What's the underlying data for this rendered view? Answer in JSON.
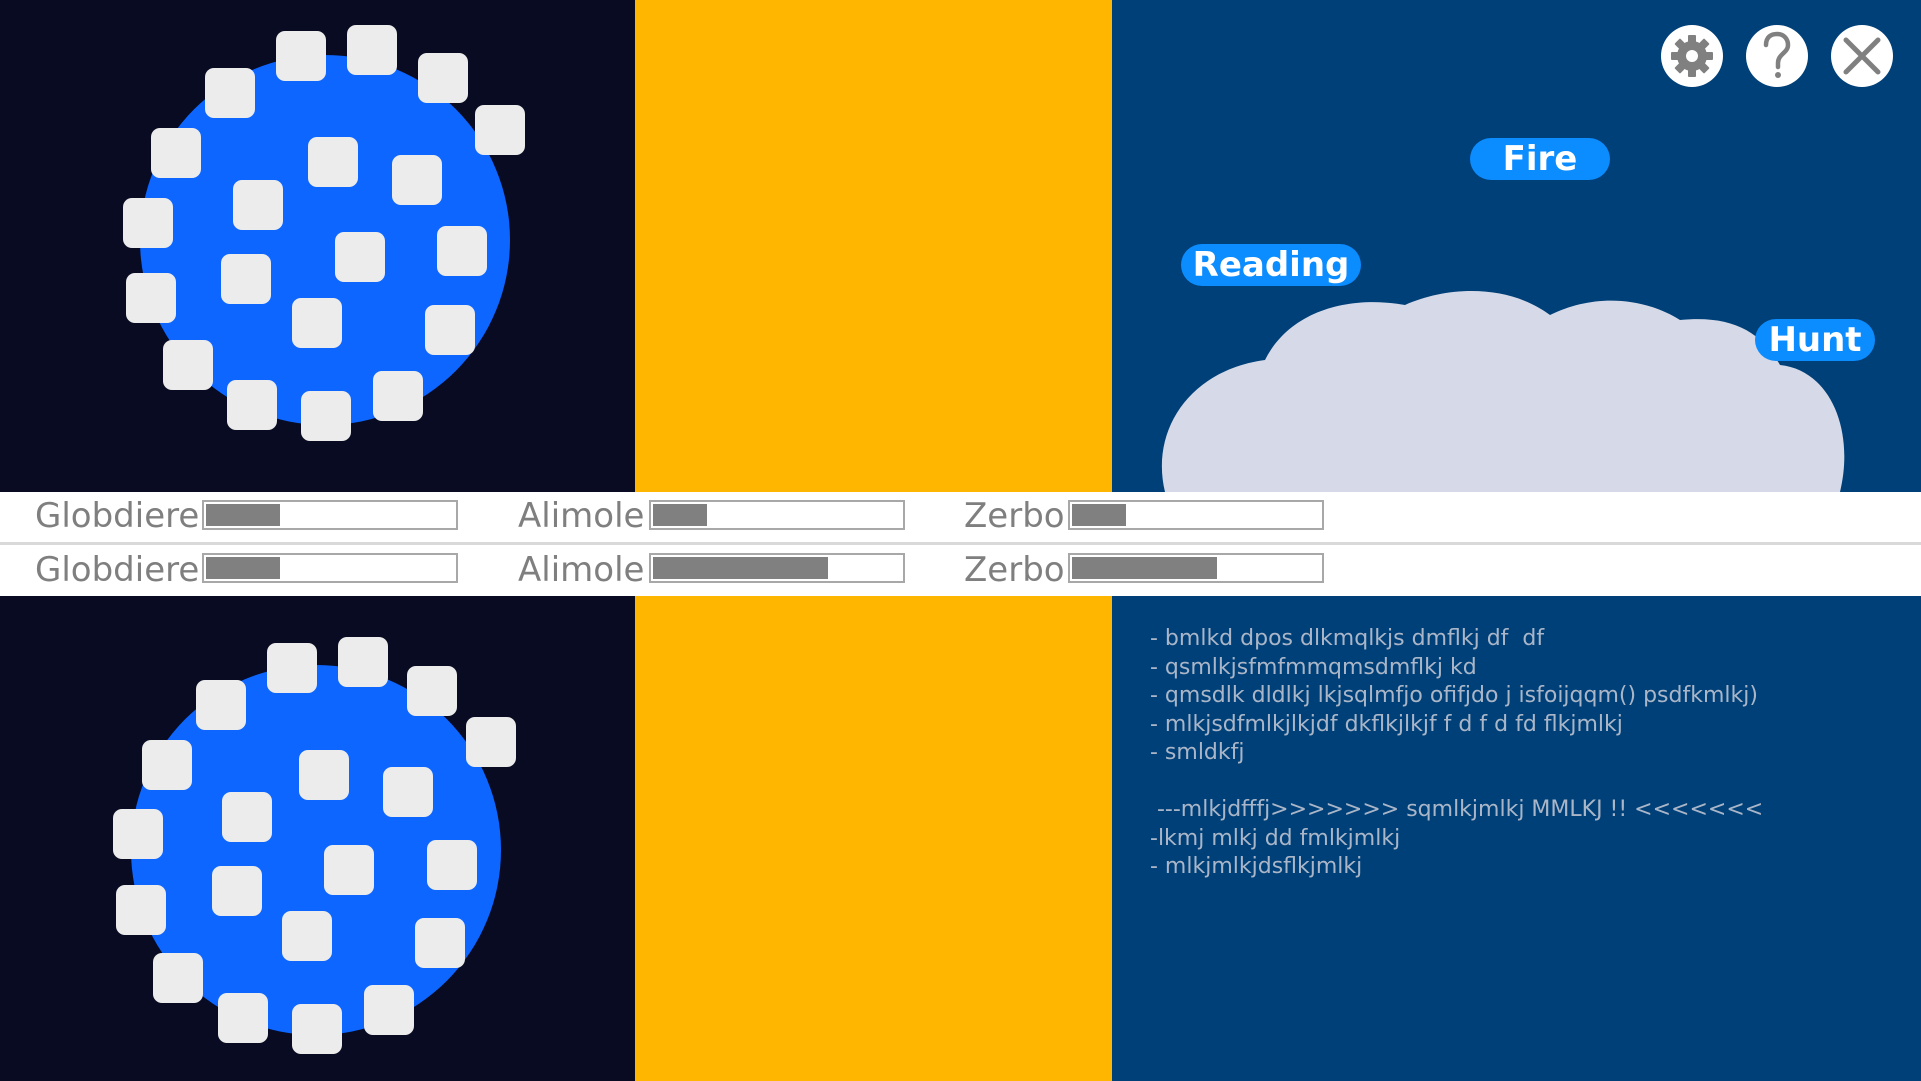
{
  "controls": {
    "settings_icon": "gear-icon",
    "help_icon": "question-icon",
    "close_icon": "close-icon"
  },
  "tags": {
    "fire": "Fire",
    "reading": "Reading",
    "hunt": "Hunt"
  },
  "stats": {
    "row1": [
      {
        "label": "Globdiere",
        "value": 0.31
      },
      {
        "label": "Alimole",
        "value": 0.23
      },
      {
        "label": "Zerbo",
        "value": 0.23
      }
    ],
    "row2": [
      {
        "label": "Globdiere",
        "value": 0.31
      },
      {
        "label": "Alimole",
        "value": 0.71
      },
      {
        "label": "Zerbo",
        "value": 0.59
      }
    ]
  },
  "notes": "- bmlkd dpos dlkmqlkjs dmflkj df  df\n- qsmlkjsfmfmmqmsdmflkj kd\n- qmsdlk dldlkj lkjsqlmfjo ofifjdo j isfoijqqm() psdfkmlkj)\n- mlkjsdfmlkjlkjdf dkflkjlkjf f d f d fd flkjmlkj\n- smldkfj\n\n ---mlkjdfffj>>>>>>> sqmlkjmlkj MMLKJ !! <<<<<<<\n-lkmj mlkj dd fmlkjmlkj\n- mlkjmlkjdsflkjmlkj",
  "colors": {
    "dark": "#080b22",
    "yellow": "#ffb600",
    "navy": "#004078",
    "planet": "#0d66ff",
    "pill": "#0b8cff",
    "cloud": "#d6dae8"
  }
}
